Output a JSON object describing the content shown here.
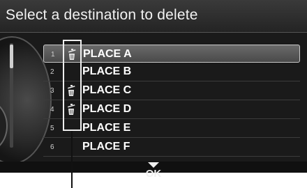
{
  "screen": {
    "title": "Select a destination to delete"
  },
  "list": {
    "items": [
      {
        "num": "1",
        "label": "PLACE A",
        "marked": true,
        "selected": true
      },
      {
        "num": "2",
        "label": "PLACE B",
        "marked": false,
        "selected": false
      },
      {
        "num": "3",
        "label": "PLACE C",
        "marked": true,
        "selected": false
      },
      {
        "num": "4",
        "label": "PLACE D",
        "marked": true,
        "selected": false
      },
      {
        "num": "5",
        "label": "PLACE E",
        "marked": false,
        "selected": false
      },
      {
        "num": "6",
        "label": "PLACE F",
        "marked": false,
        "selected": false
      }
    ]
  },
  "footer": {
    "ok_label": "OK"
  },
  "icons": {
    "delete_mark": "trash-icon",
    "ok": "down-arrow-icon"
  },
  "colors": {
    "background": "#1a1a1a",
    "text": "#ffffff",
    "highlight": "#eeeeee"
  }
}
